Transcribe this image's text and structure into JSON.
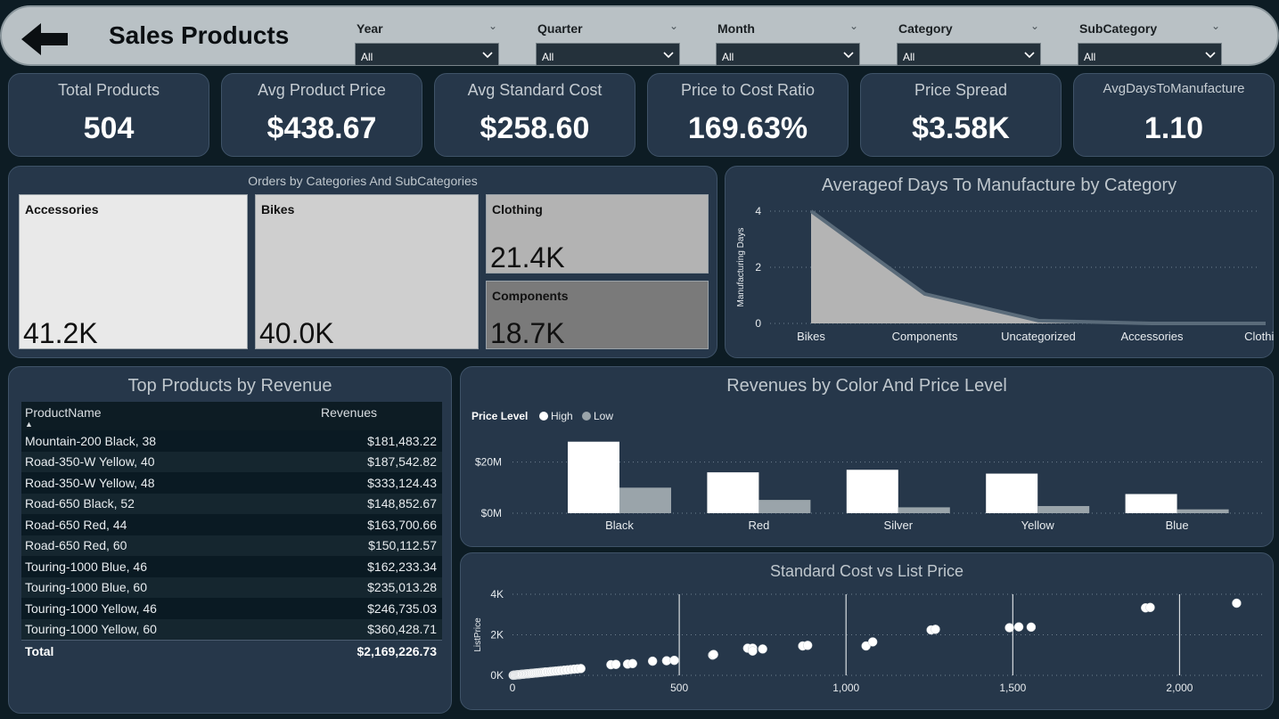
{
  "header": {
    "title": "Sales Products",
    "slicers": [
      {
        "label": "Year",
        "value": "All"
      },
      {
        "label": "Quarter",
        "value": "All"
      },
      {
        "label": "Month",
        "value": "All"
      },
      {
        "label": "Category",
        "value": "All"
      },
      {
        "label": "SubCategory",
        "value": "All"
      }
    ],
    "back_icon": "back-arrow-icon"
  },
  "kpis": [
    {
      "title": "Total Products",
      "value": "504"
    },
    {
      "title": "Avg Product Price",
      "value": "$438.67"
    },
    {
      "title": "Avg Standard Cost",
      "value": "$258.60"
    },
    {
      "title": "Price to Cost Ratio",
      "value": "169.63%"
    },
    {
      "title": "Price Spread",
      "value": "$3.58K"
    },
    {
      "title": "AvgDaysToManufacture",
      "value": "1.10"
    }
  ],
  "treemap": {
    "title": "Orders by Categories And SubCategories",
    "tiles": [
      {
        "name": "Accessories",
        "value": "41.2K",
        "color": "#e9e9e9"
      },
      {
        "name": "Bikes",
        "value": "40.0K",
        "color": "#cfcfcf"
      },
      {
        "name": "Clothing",
        "value": "21.4K",
        "color": "#b3b3b3"
      },
      {
        "name": "Components",
        "value": "18.7K",
        "color": "#7a7a7a"
      }
    ]
  },
  "top_products": {
    "title": "Top Products by Revenue",
    "columns": [
      "ProductName",
      "Revenues"
    ],
    "rows": [
      [
        "Mountain-200 Black, 38",
        "$181,483.22"
      ],
      [
        "Road-350-W Yellow, 40",
        "$187,542.82"
      ],
      [
        "Road-350-W Yellow, 48",
        "$333,124.43"
      ],
      [
        "Road-650 Black, 52",
        "$148,852.67"
      ],
      [
        "Road-650 Red, 44",
        "$163,700.66"
      ],
      [
        "Road-650 Red, 60",
        "$150,112.57"
      ],
      [
        "Touring-1000 Blue, 46",
        "$162,233.34"
      ],
      [
        "Touring-1000 Blue, 60",
        "$235,013.28"
      ],
      [
        "Touring-1000 Yellow, 46",
        "$246,735.03"
      ],
      [
        "Touring-1000 Yellow, 60",
        "$360,428.71"
      ]
    ],
    "total_label": "Total",
    "total_value": "$2,169,226.73"
  },
  "chart_data": [
    {
      "type": "area",
      "title": "Averageof Days To Manufacture by Category",
      "xlabel": "",
      "ylabel": "Manufacturing Days",
      "categories": [
        "Bikes",
        "Components",
        "Uncategorized",
        "Accessories",
        "Clothing"
      ],
      "values": [
        4,
        1.05,
        0.1,
        0,
        0
      ],
      "ylim": [
        0,
        4
      ],
      "yticks": [
        "0",
        "2",
        "4"
      ],
      "grid": true,
      "fill_color": "#b4b4b4",
      "line_color": "#5a6b7a"
    },
    {
      "type": "bar",
      "title": "Revenues by Color And Price Level",
      "legend_title": "Price Level",
      "legend_position": "top-left",
      "categories": [
        "Black",
        "Red",
        "Silver",
        "Yellow",
        "Blue"
      ],
      "series": [
        {
          "name": "High",
          "values": [
            28,
            16,
            17,
            15.5,
            7.5
          ],
          "color": "#ffffff"
        },
        {
          "name": "Low",
          "values": [
            10,
            5.2,
            2.3,
            2.8,
            1.5
          ],
          "color": "#9aa4aa"
        }
      ],
      "unit": "M",
      "yticks": [
        "$0M",
        "$20M"
      ],
      "ylim": [
        0,
        30
      ]
    },
    {
      "type": "scatter",
      "title": "Standard Cost vs List Price",
      "xlabel": "",
      "ylabel": "ListPrice",
      "xticks": [
        "0",
        "500",
        "1,000",
        "1,500",
        "2,000"
      ],
      "yticks": [
        "0K",
        "2K",
        "4K"
      ],
      "xlim": [
        0,
        2250
      ],
      "ylim": [
        0,
        4000
      ],
      "color": "#ffffff",
      "points": [
        [
          2,
          4
        ],
        [
          5,
          9
        ],
        [
          7,
          14
        ],
        [
          10,
          21
        ],
        [
          13,
          25
        ],
        [
          16,
          30
        ],
        [
          19,
          34
        ],
        [
          22,
          38
        ],
        [
          25,
          45
        ],
        [
          28,
          50
        ],
        [
          32,
          55
        ],
        [
          36,
          63
        ],
        [
          40,
          70
        ],
        [
          44,
          75
        ],
        [
          48,
          80
        ],
        [
          52,
          88
        ],
        [
          56,
          95
        ],
        [
          60,
          100
        ],
        [
          65,
          110
        ],
        [
          70,
          118
        ],
        [
          75,
          125
        ],
        [
          80,
          133
        ],
        [
          85,
          140
        ],
        [
          90,
          150
        ],
        [
          95,
          158
        ],
        [
          100,
          168
        ],
        [
          108,
          175
        ],
        [
          115,
          190
        ],
        [
          122,
          200
        ],
        [
          130,
          213
        ],
        [
          138,
          225
        ],
        [
          146,
          238
        ],
        [
          155,
          255
        ],
        [
          165,
          270
        ],
        [
          175,
          288
        ],
        [
          185,
          305
        ],
        [
          195,
          320
        ],
        [
          205,
          335
        ],
        [
          295,
          525
        ],
        [
          310,
          540
        ],
        [
          345,
          555
        ],
        [
          360,
          580
        ],
        [
          420,
          700
        ],
        [
          462,
          720
        ],
        [
          485,
          740
        ],
        [
          600,
          1000
        ],
        [
          603,
          1030
        ],
        [
          705,
          1340
        ],
        [
          720,
          1340
        ],
        [
          750,
          1300
        ],
        [
          720,
          1200
        ],
        [
          870,
          1450
        ],
        [
          885,
          1480
        ],
        [
          1060,
          1450
        ],
        [
          1080,
          1650
        ],
        [
          1255,
          2240
        ],
        [
          1268,
          2270
        ],
        [
          1490,
          2350
        ],
        [
          1518,
          2390
        ],
        [
          1555,
          2380
        ],
        [
          1898,
          3330
        ],
        [
          1912,
          3350
        ],
        [
          2171,
          3560
        ]
      ]
    }
  ]
}
